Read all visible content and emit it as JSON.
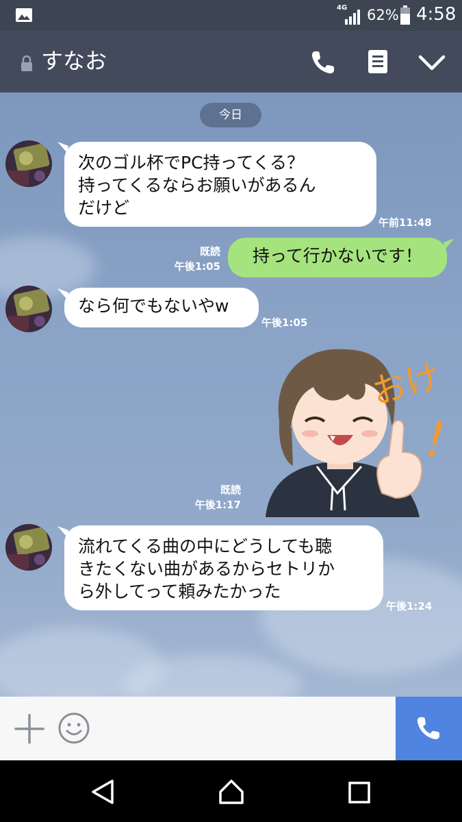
{
  "status_bar": {
    "network": "4G",
    "battery_percent": "62%",
    "time": "4:58",
    "icons": [
      "image-notification-icon",
      "signal-icon",
      "battery-icon"
    ]
  },
  "header": {
    "title": "すなお",
    "icons": [
      "lock-icon",
      "call-icon",
      "notes-icon",
      "chevron-down-icon"
    ]
  },
  "chat": {
    "date_label": "今日",
    "messages": [
      {
        "side": "in",
        "text": "次のゴル杯でPC持ってくる？\n持ってくるならお願いがあるん\nだけど",
        "time": "午前11:48"
      },
      {
        "side": "out",
        "text": "持って行かないです！",
        "read": "既読",
        "time": "午後1:05"
      },
      {
        "side": "in",
        "text": "なら何でもないやw",
        "time": "午後1:05"
      },
      {
        "side": "out",
        "sticker": "thumbs-up-boy",
        "sticker_text": "おけ！",
        "read": "既読",
        "time": "午後1:17"
      },
      {
        "side": "in",
        "text": "流れてくる曲の中にどうしても聴\nきたくない曲があるからセトリか\nら外してって頼みたかった",
        "time": "午後1:24"
      }
    ]
  },
  "input_bar": {
    "icons": [
      "plus-icon",
      "emoji-icon",
      "call-icon"
    ],
    "accent": "#4f84e0"
  },
  "nav_bar": {
    "icons": [
      "back-icon",
      "home-icon",
      "recents-icon"
    ]
  },
  "colors": {
    "header": "#424a5c",
    "status": "#3d4553",
    "outgoing_bubble": "#a5e37e",
    "incoming_bubble": "#ffffff"
  }
}
